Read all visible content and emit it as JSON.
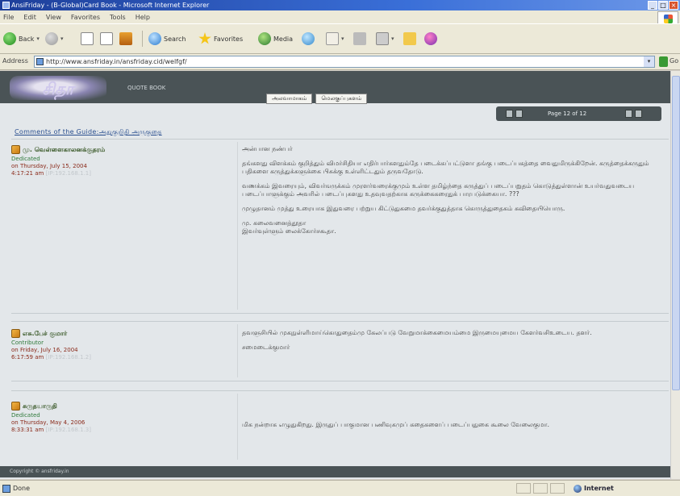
{
  "window": {
    "title": "AnsiFriday - (B-Global)Card Book - Microsoft Internet Explorer"
  },
  "menu": [
    "File",
    "Edit",
    "View",
    "Favorites",
    "Tools",
    "Help"
  ],
  "toolbar": {
    "back": "Back",
    "search": "Search",
    "favorites": "Favorites",
    "media": "Media"
  },
  "address": {
    "label": "Address",
    "url": "http://www.ansfriday.in/ansfriday.cid/welfgf/",
    "go": "Go"
  },
  "site": {
    "logo": "சிதா",
    "subtitle": "QUOTE BOOK",
    "nav": [
      "அலவாமாகம்",
      "மெலகுப்புகளம்"
    ]
  },
  "pager": {
    "text": "Page 12 of 12"
  },
  "forum_link": "Comments of the Guide:அதுகுறிதி அருகுதை",
  "posts": [
    {
      "author": "மு. வெள்ளைகாலனக்குதரம்",
      "role": "Dedicated",
      "date": "on Thursday, July 15, 2004",
      "time": "4:17:21 am",
      "time_meta": "[IP:192.168.1.1]",
      "body": [
        "அன்பான நண்பர்",
        "தங்களது விளக்கம் குறித்தும் விமர்சிதியா எதிர்பார்களதும்தே படைக்கப்பட்டுளா தங்கு படைப்பகத்தை வைதுமிருக்கிறேன். கருத்தைக்கருதும் பதிகளை கருத்துக்களுக்கை பிசுக்கு உள்ளிட்டதும் தருவதோடு.",
        "வணக்கம் இவரையும், விவர்ஙருக்கம் முரளர்வரைக்குமும் உள்ள தமிழ்ந்தை கருத்துப் படைப்பறுதம் கொடுத்துள்ளான் உயர்வதுவடைய படைப்பாளுக்கும் அவரில் படைப்புகளது உதவுவதற்காக கருக்கைகரைதுக் பாரபடுக்கையா. ???",
        "முழுதானம் முத்து உரையாக இதுவரை பற்றுய கிட்டுதுகமை தவர்க்குதுத்தாக கொருத்துதைகம் கவிதையியொரு.",
        "மு. கலைவனைத்தூதா\nஇவர்வுள்ளும் லைக்கோர்சகூதா."
      ]
    },
    {
      "author": "எசு.பேச் குமார்",
      "role": "Contributor",
      "date": "on Friday, July 16, 2004",
      "time": "6:17:59 am",
      "time_meta": "[IP:192.168.1.2]",
      "body": [
        "தவளுசியில் முகநுள்ளிமாய்கொதுதைம்மு கேலப்படு வேறுமாக்கைமையம்மை இருமையுமைய கேளர்வசிஉடைய. தளர்.",
        "சமைடைக்குமார்"
      ]
    },
    {
      "author": "சுருதயாருதி",
      "role": "Dedicated",
      "date": "on Thursday, May 4, 2006",
      "time": "8:33:31 am",
      "time_meta": "[IP:192.168.1.3]",
      "body": [
        "மிக நன்றாக எழுதுகிறது. இருதுப் பாகுமான பணிவுகமுப் கதைகளைப் படைப்பதுகை கூலை வேலைகுமா."
      ]
    }
  ],
  "footer": "Copyright © ansfriday.in",
  "status": {
    "left": "Done",
    "zone": "Internet"
  }
}
